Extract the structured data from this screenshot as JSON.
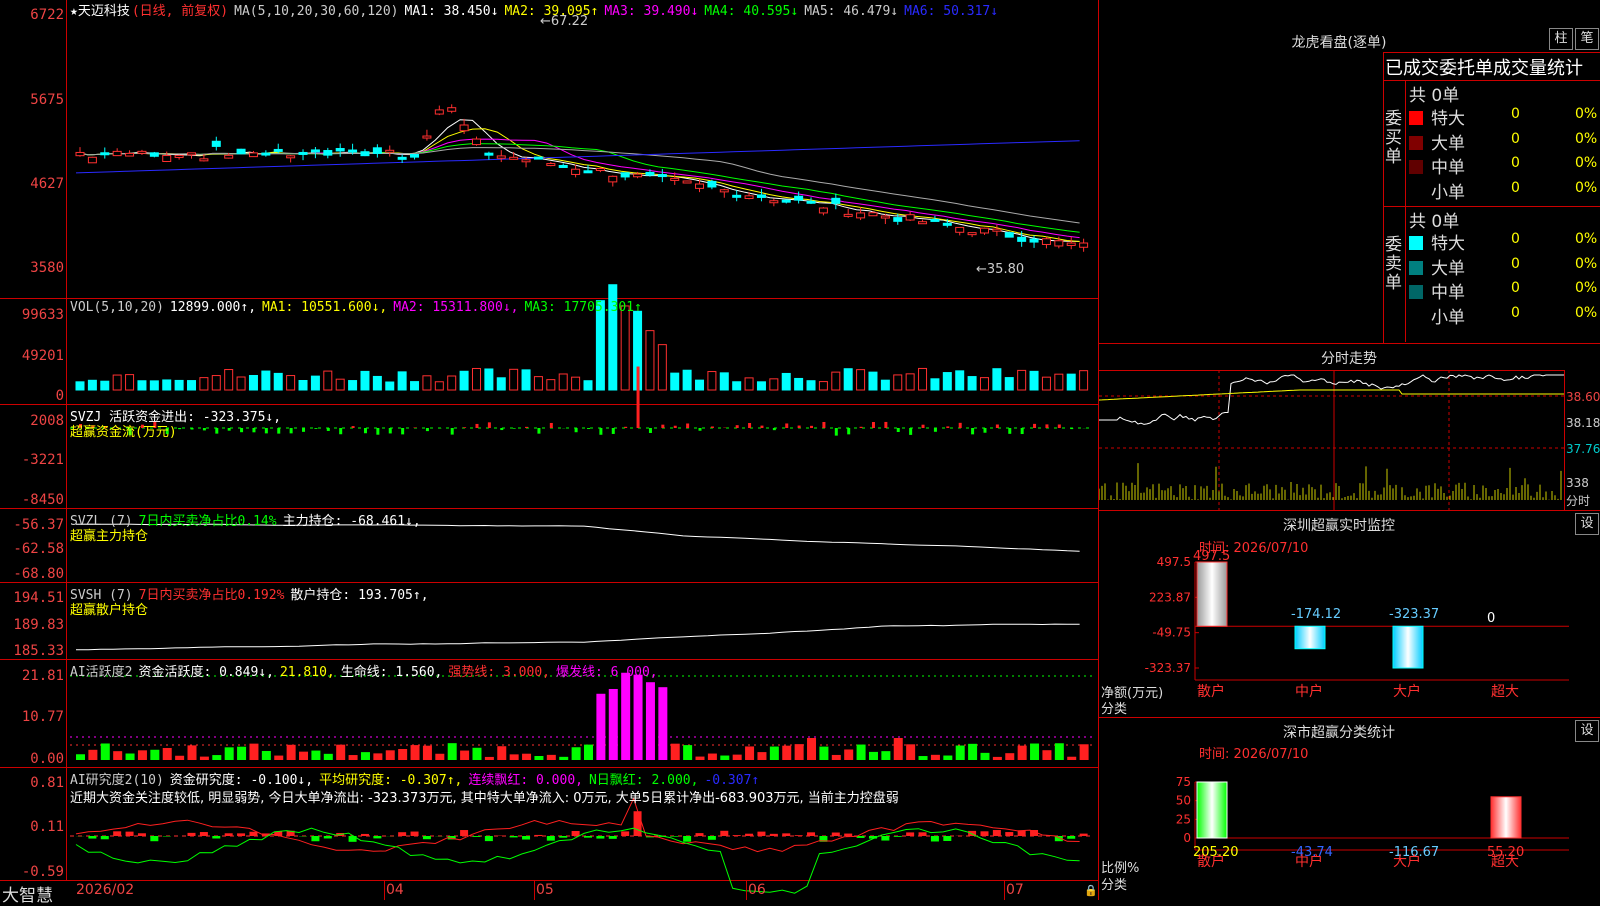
{
  "stock": {
    "name": "★天迈科技",
    "period": "(日线, 前复权)",
    "ma_label": "MA(5,10,20,30,60,120)",
    "ma": [
      {
        "label": "MA1: 38.450↓",
        "color": "#ffffff"
      },
      {
        "label": "MA2: 39.095↑",
        "color": "#ffff00"
      },
      {
        "label": "MA3: 39.490↓",
        "color": "#ff00ff"
      },
      {
        "label": "MA4: 40.595↓",
        "color": "#00ff00"
      },
      {
        "label": "MA5: 46.479↓",
        "color": "#cccccc"
      },
      {
        "label": "MA6: 50.317↓",
        "color": "#2a2aff"
      }
    ],
    "price_high": "67.22",
    "price_low": "35.80",
    "yaxis": [
      "6722",
      "5675",
      "4627",
      "3580"
    ]
  },
  "vol": {
    "labels": [
      {
        "text": "VOL(5,10,20)",
        "color": "#cccccc"
      },
      {
        "text": "12899.000↑,",
        "color": "#ffffff"
      },
      {
        "text": "MA1: 10551.600↓,",
        "color": "#ffff00"
      },
      {
        "text": "MA2: 15311.800↓,",
        "color": "#ff00ff"
      },
      {
        "text": "MA3: 17705.301↑",
        "color": "#00ff00"
      }
    ],
    "yaxis": [
      "99633",
      "49201",
      "0"
    ]
  },
  "svzj": {
    "line1": [
      {
        "text": "SVZJ  活跃资金进出: -323.375↓,",
        "color": "#ffffff"
      }
    ],
    "line2": "超赢资金流(万元)",
    "yaxis": [
      "2008",
      "-3221",
      "-8450"
    ]
  },
  "svzl": {
    "line1": [
      {
        "text": "SVZL (7)",
        "color": "#cccccc"
      },
      {
        "text": "7日内买卖净占比0.14%",
        "color": "#00ff00"
      },
      {
        "text": "主力持仓: -68.461↓,",
        "color": "#ffffff"
      }
    ],
    "line2": "超赢主力持仓",
    "yaxis": [
      "-56.37",
      "-62.58",
      "-68.80"
    ]
  },
  "svsh": {
    "line1": [
      {
        "text": "SVSH (7)",
        "color": "#cccccc"
      },
      {
        "text": "7日内买卖净占比0.192%",
        "color": "#ff3030"
      },
      {
        "text": "散户持仓: 193.705↑,",
        "color": "#ffffff"
      }
    ],
    "line2": "超赢散户持仓",
    "yaxis": [
      "194.51",
      "189.83",
      "185.33"
    ]
  },
  "ai1": {
    "line1": [
      {
        "text": "AI活跃度2",
        "color": "#cccccc"
      },
      {
        "text": "资金活跃度: 0.849↓,",
        "color": "#ffffff"
      },
      {
        "text": "21.810,",
        "color": "#ffff00"
      },
      {
        "text": "生命线: 1.560,",
        "color": "#ffffff"
      },
      {
        "text": "强势线: 3.000,",
        "color": "#ff3030"
      },
      {
        "text": "爆发线: 6.000,",
        "color": "#ff00ff"
      }
    ],
    "yaxis": [
      "21.81",
      "10.77",
      "0.00"
    ]
  },
  "ai2": {
    "line1": [
      {
        "text": "AI研究度2(10)",
        "color": "#cccccc"
      },
      {
        "text": "资金研究度: -0.100↓,",
        "color": "#ffffff"
      },
      {
        "text": "平均研究度: -0.307↑,",
        "color": "#ffff00"
      },
      {
        "text": "连续飘红: 0.000,",
        "color": "#ff00ff"
      },
      {
        "text": "N日飘红: 2.000,",
        "color": "#00ff00"
      },
      {
        "text": "-0.307↑",
        "color": "#2a2aff"
      }
    ],
    "comment": "近期大资金关注度较低, 明显弱势, 今日大单净流出: -323.373万元, 其中特大单净流入: 0万元, 大单5日累计净出-683.903万元, 当前主力控盘弱",
    "yaxis": [
      "0.81",
      "0.11",
      "-0.59"
    ]
  },
  "xaxis": {
    "brand": "大智慧",
    "months": [
      "2026/02",
      "04",
      "05",
      "06",
      "07"
    ]
  },
  "longhu": {
    "title": "龙虎看盘(逐单)",
    "btn_zhu": "柱",
    "btn_bi": "笔",
    "subtitle": "已成交委托单成交量统计",
    "buy_label": "委买单",
    "sell_label": "委卖单",
    "buy_total": "共 0单",
    "sell_total": "共 0单",
    "buy_rows": [
      {
        "name": "特大",
        "count": "0",
        "pct": "0%",
        "color": "#ff0000"
      },
      {
        "name": "大单",
        "count": "0",
        "pct": "0%",
        "color": "#800000"
      },
      {
        "name": "中单",
        "count": "0",
        "pct": "0%",
        "color": "#600000"
      },
      {
        "name": "小单",
        "count": "0",
        "pct": "0%",
        "color": ""
      }
    ],
    "sell_rows": [
      {
        "name": "特大",
        "count": "0",
        "pct": "0%",
        "color": "#00ffff"
      },
      {
        "name": "大单",
        "count": "0",
        "pct": "0%",
        "color": "#008080"
      },
      {
        "name": "中单",
        "count": "0",
        "pct": "0%",
        "color": "#006666"
      },
      {
        "name": "小单",
        "count": "0",
        "pct": "0%",
        "color": ""
      }
    ]
  },
  "fenshi": {
    "title": "分时走势",
    "yaxis": [
      "38.60",
      "38.18",
      "37.76",
      "338"
    ],
    "vol_label": "分时"
  },
  "monitor": {
    "title": "深圳超赢实时监控",
    "btn": "设",
    "time": "时间: 2026/07/10",
    "yaxis": [
      "497.5",
      "223.87",
      "-49.75",
      "-323.37"
    ],
    "ylabel": "净额(万元)",
    "xlabel": "分类",
    "values": [
      "497.5",
      "-174.12",
      "-323.37",
      "0"
    ],
    "categories": [
      "散户",
      "中户",
      "大户",
      "超大"
    ]
  },
  "classify": {
    "title": "深市超赢分类统计",
    "btn": "设",
    "time": "时间: 2026/07/10",
    "yaxis": [
      "75",
      "50",
      "25",
      "0"
    ],
    "ylabel": "比例%",
    "xlabel": "分类",
    "values": [
      "205.20",
      "-43.74",
      "-116.67",
      "55.20"
    ],
    "categories": [
      "散户",
      "中户",
      "大户",
      "超大"
    ]
  },
  "chart_data": [
    {
      "type": "bar",
      "title": "深圳超赢实时监控",
      "ylabel": "净额(万元)",
      "xlabel": "分类",
      "categories": [
        "散户",
        "中户",
        "大户",
        "超大"
      ],
      "values": [
        497.5,
        -174.12,
        -323.37,
        0
      ],
      "ylim": [
        -323.37,
        497.5
      ]
    },
    {
      "type": "bar",
      "title": "深市超赢分类统计",
      "ylabel": "比例%",
      "xlabel": "分类",
      "categories": [
        "散户",
        "中户",
        "大户",
        "超大"
      ],
      "values": [
        205.2,
        -43.74,
        -116.67,
        55.2
      ],
      "ylim": [
        0,
        75
      ]
    }
  ]
}
